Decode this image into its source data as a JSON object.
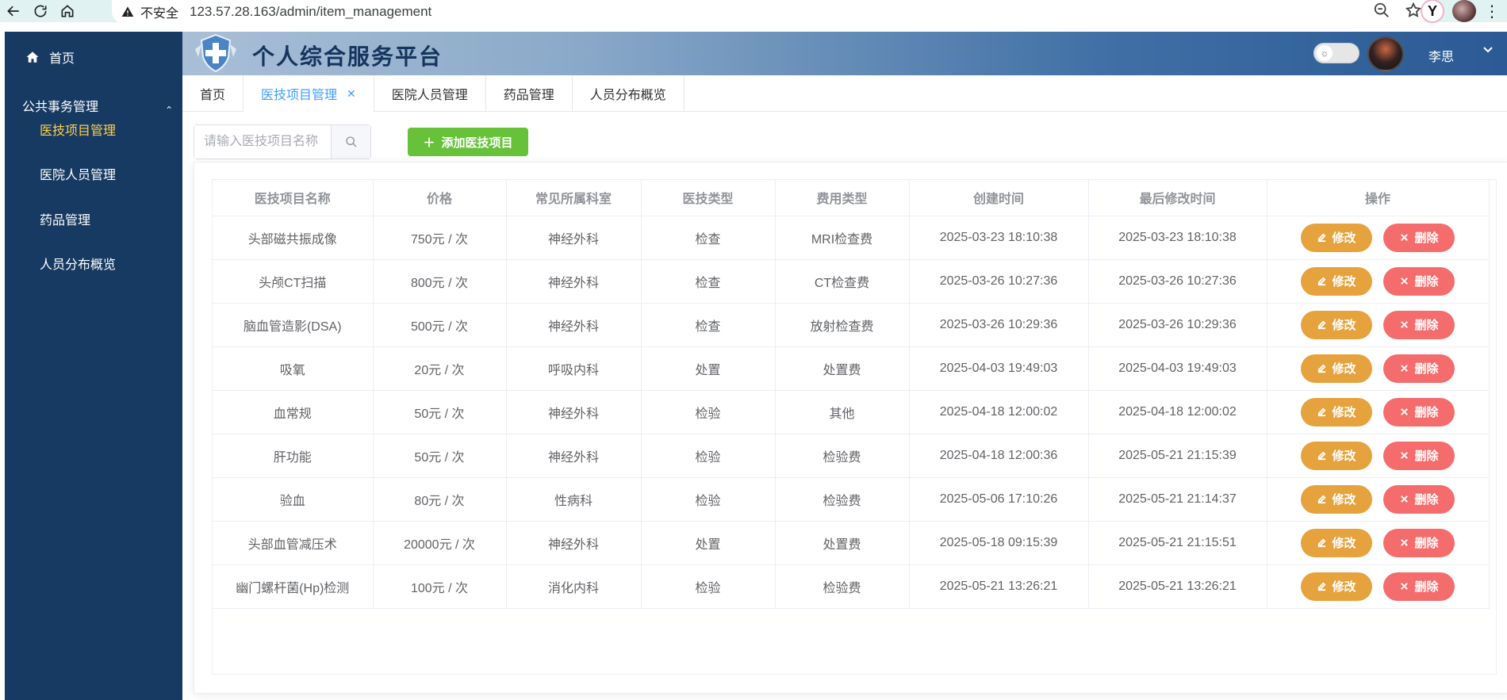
{
  "browser": {
    "insecure_label": "不安全",
    "url": "123.57.28.163/admin/item_management"
  },
  "sidebar": {
    "home_label": "首页",
    "group_label": "公共事务管理",
    "items": [
      {
        "label": "医技项目管理",
        "active": true
      },
      {
        "label": "医院人员管理",
        "active": false
      },
      {
        "label": "药品管理",
        "active": false
      },
      {
        "label": "人员分布概览",
        "active": false
      }
    ]
  },
  "header": {
    "title": "个人综合服务平台",
    "user_name": "李思"
  },
  "tabs": [
    {
      "label": "首页",
      "active": false
    },
    {
      "label": "医技项目管理",
      "active": true,
      "closable": true
    },
    {
      "label": "医院人员管理",
      "active": false
    },
    {
      "label": "药品管理",
      "active": false
    },
    {
      "label": "人员分布概览",
      "active": false
    }
  ],
  "toolbar": {
    "search_placeholder": "请输入医技项目名称",
    "search_value": "",
    "add_label": "添加医技项目"
  },
  "table": {
    "columns": [
      "医技项目名称",
      "价格",
      "常见所属科室",
      "医技类型",
      "费用类型",
      "创建时间",
      "最后修改时间",
      "操作"
    ],
    "edit_label": "修改",
    "delete_label": "删除",
    "rows": [
      [
        "头部磁共振成像",
        "750元 / 次",
        "神经外科",
        "检查",
        "MRI检查费",
        "2025-03-23 18:10:38",
        "2025-03-23 18:10:38"
      ],
      [
        "头颅CT扫描",
        "800元 / 次",
        "神经外科",
        "检查",
        "CT检查费",
        "2025-03-26 10:27:36",
        "2025-03-26 10:27:36"
      ],
      [
        "脑血管造影(DSA)",
        "500元 / 次",
        "神经外科",
        "检查",
        "放射检查费",
        "2025-03-26 10:29:36",
        "2025-03-26 10:29:36"
      ],
      [
        "吸氧",
        "20元 / 次",
        "呼吸内科",
        "处置",
        "处置费",
        "2025-04-03 19:49:03",
        "2025-04-03 19:49:03"
      ],
      [
        "血常规",
        "50元 / 次",
        "神经外科",
        "检验",
        "其他",
        "2025-04-18 12:00:02",
        "2025-04-18 12:00:02"
      ],
      [
        "肝功能",
        "50元 / 次",
        "神经外科",
        "检验",
        "检验费",
        "2025-04-18 12:00:36",
        "2025-05-21 21:15:39"
      ],
      [
        "验血",
        "80元 / 次",
        "性病科",
        "检验",
        "检验费",
        "2025-05-06 17:10:26",
        "2025-05-21 21:14:37"
      ],
      [
        "头部血管减压术",
        "20000元 / 次",
        "神经外科",
        "处置",
        "处置费",
        "2025-05-18 09:15:39",
        "2025-05-21 21:15:51"
      ],
      [
        "幽门螺杆菌(Hp)检测",
        "100元 / 次",
        "消化内科",
        "检验",
        "检验费",
        "2025-05-21 13:26:21",
        "2025-05-21 13:26:21"
      ]
    ]
  },
  "colors": {
    "sidebar_bg": "#173a62",
    "sidebar_active": "#ffd04b",
    "tab_active": "#409eff",
    "add_button": "#67c23a",
    "edit_button": "#e6a23c",
    "delete_button": "#f56c6c"
  }
}
